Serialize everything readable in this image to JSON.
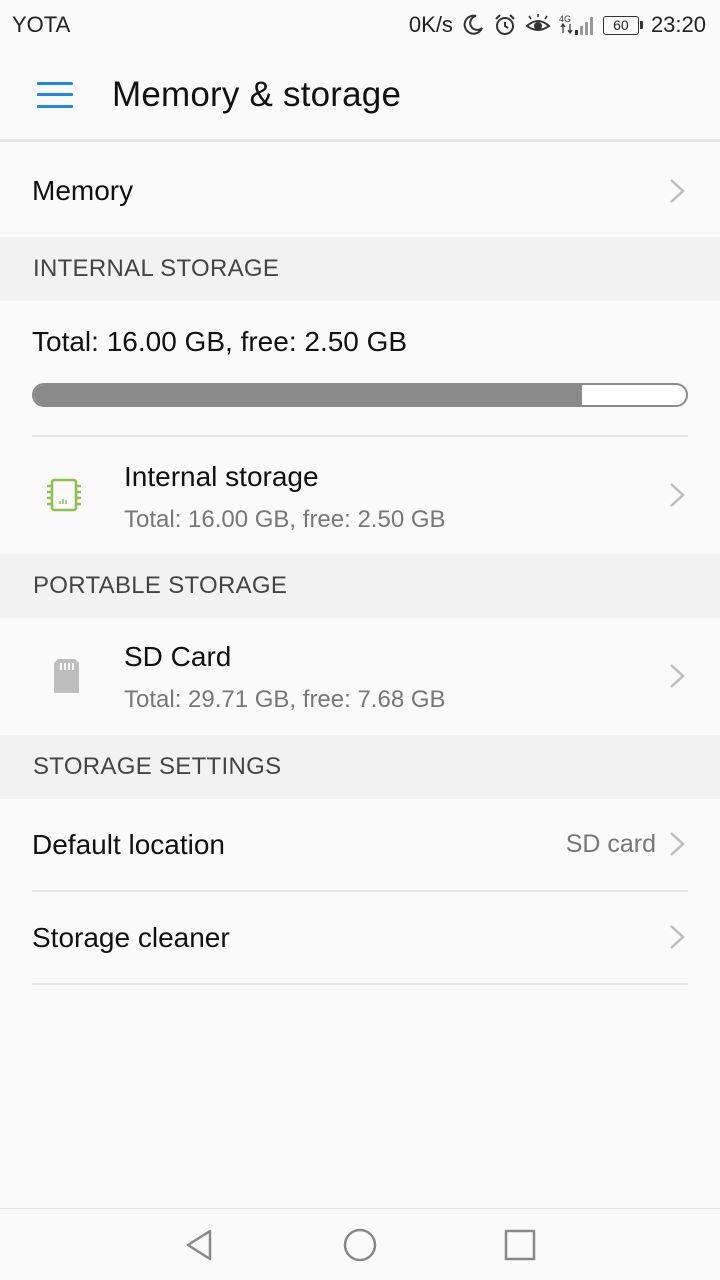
{
  "status_bar": {
    "carrier": "YOTA",
    "speed": "0K/s",
    "network": "4G",
    "battery": "60",
    "time": "23:20"
  },
  "app_bar": {
    "title": "Memory & storage",
    "menu_icon": "hamburger-menu-icon",
    "accent_color": "#1e88e5"
  },
  "memory": {
    "label": "Memory"
  },
  "internal_storage": {
    "header": "INTERNAL STORAGE",
    "summary": "Total: 16.00 GB, free: 2.50 GB",
    "used_fraction": 0.84,
    "item": {
      "title": "Internal storage",
      "subtitle": "Total: 16.00 GB, free: 2.50 GB",
      "icon": "chip-icon",
      "icon_color": "#8bc34a"
    }
  },
  "portable_storage": {
    "header": "PORTABLE STORAGE",
    "item": {
      "title": "SD Card",
      "subtitle": "Total: 29.71 GB, free: 7.68 GB",
      "icon": "sd-card-icon"
    }
  },
  "storage_settings": {
    "header": "STORAGE SETTINGS",
    "default_location": {
      "label": "Default location",
      "value": "SD card"
    },
    "storage_cleaner": {
      "label": "Storage cleaner"
    }
  },
  "nav_bar": {
    "back_icon": "back-triangle-icon",
    "home_icon": "home-circle-icon",
    "recents_icon": "recents-square-icon"
  }
}
